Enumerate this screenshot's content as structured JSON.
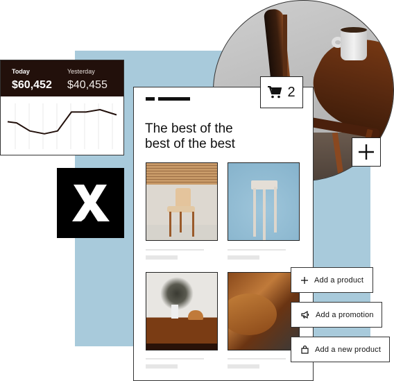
{
  "stats_card": {
    "today_label": "Today",
    "today_value": "$60,452",
    "yesterday_label": "Yesterday",
    "yesterday_value": "$40,455",
    "trend_values": [
      58,
      55,
      35,
      28,
      35,
      82,
      82,
      88,
      75
    ],
    "line_color": "#22100b",
    "header_color": "#22100b"
  },
  "brand": {
    "logo_letter": "X"
  },
  "storefront": {
    "headline_line1": "The best of the",
    "headline_line2": "best of the best",
    "products": [
      {
        "name": "wooden-chair"
      },
      {
        "name": "bar-stool"
      },
      {
        "name": "sideboard-with-vase"
      },
      {
        "name": "round-table-with-leather-chairs"
      }
    ]
  },
  "cart": {
    "icon": "cart-icon",
    "count": "2"
  },
  "plus_button": {
    "icon": "plus-icon"
  },
  "actions": [
    {
      "icon": "plus-icon",
      "label": "Add a product"
    },
    {
      "icon": "megaphone-icon",
      "label": "Add a promotion"
    },
    {
      "icon": "shopping-bag-icon",
      "label": "Add a new product"
    }
  ],
  "colors": {
    "accent_blue": "#a8cadb",
    "dark": "#22100b"
  }
}
